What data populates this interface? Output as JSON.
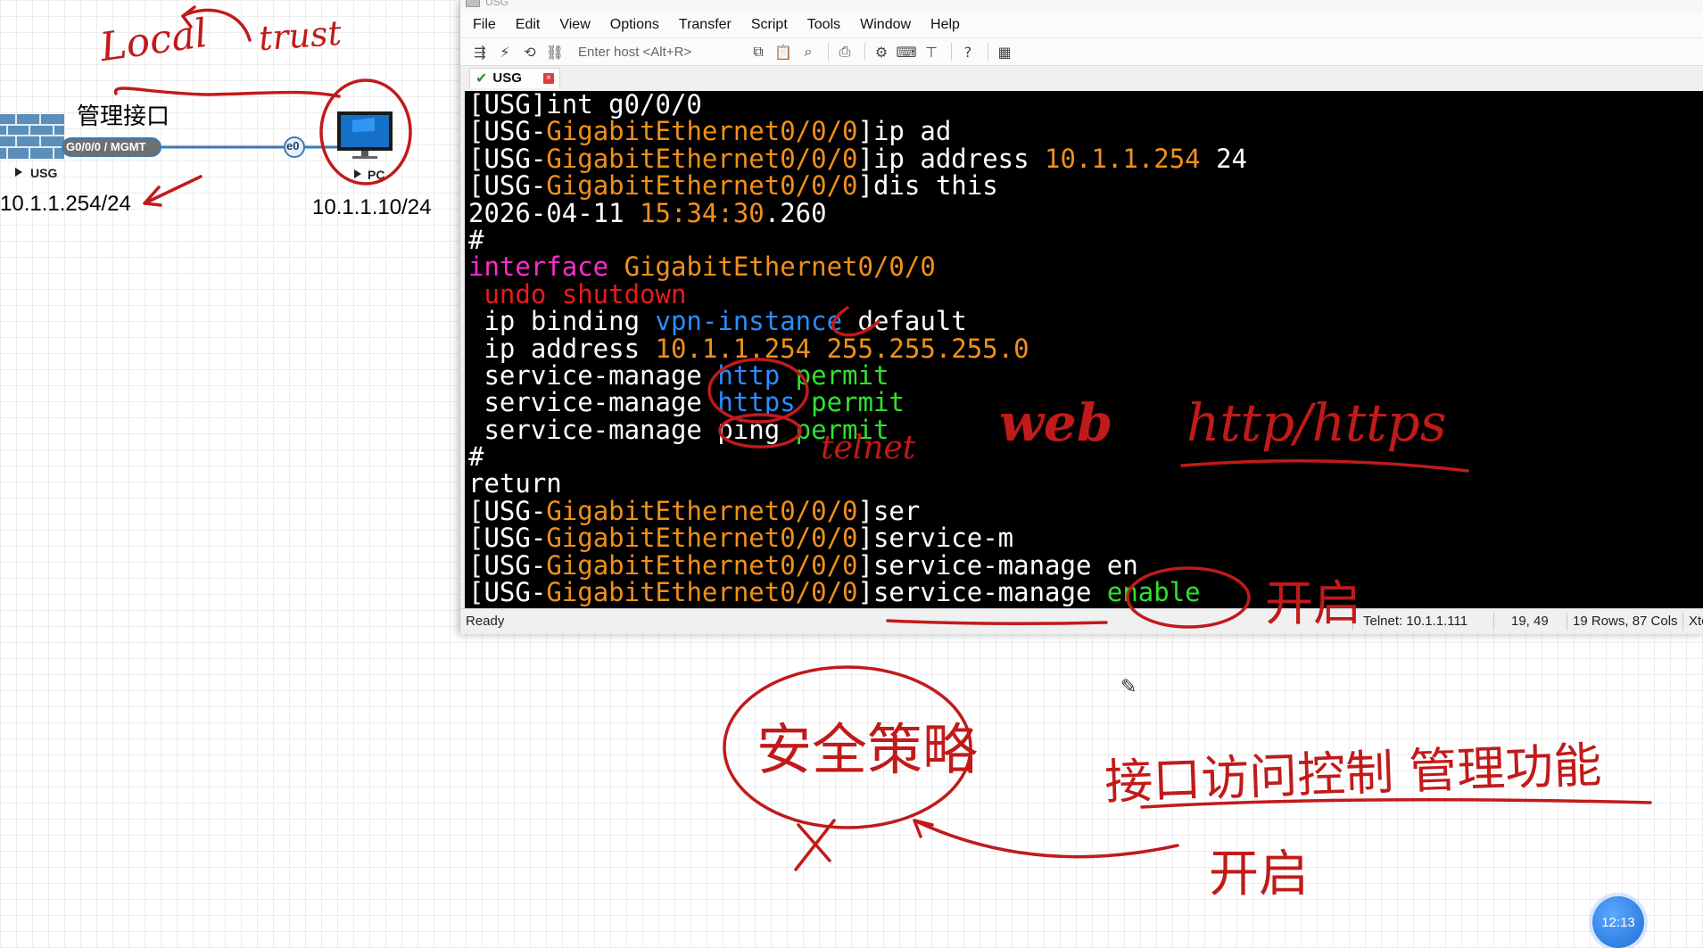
{
  "topology": {
    "nodes": [
      {
        "label": "USG",
        "icon": "firewall-icon"
      },
      {
        "label": "PC",
        "icon": "pc-icon"
      }
    ],
    "link": {
      "left_port": "G0/0/0 / MGMT",
      "right_port": "e0"
    },
    "usg_ip": "10.1.1.254/24",
    "pc_ip": "10.1.1.10/24",
    "mgmt_label": "管理接口"
  },
  "window": {
    "title": "USG",
    "menu": [
      "File",
      "Edit",
      "View",
      "Options",
      "Transfer",
      "Script",
      "Tools",
      "Window",
      "Help"
    ],
    "toolbar": {
      "host_placeholder": "Enter host <Alt+R>",
      "icons": [
        "connect-icon",
        "quick-connect-icon",
        "reconnect-icon",
        "disconnect-icon",
        "copy-icon",
        "paste-icon",
        "find-icon",
        "print-icon",
        "settings-icon",
        "keymap-icon",
        "sftp-icon",
        "help-icon",
        "map-icon"
      ]
    },
    "tab": {
      "label": "USG",
      "connected": true,
      "status_icon": "check-icon",
      "close_icon": "close-icon"
    },
    "terminal_lines": [
      [
        {
          "t": "[USG]int g0/0/0",
          "c": "w"
        }
      ],
      [
        {
          "t": "[USG-",
          "c": "w"
        },
        {
          "t": "GigabitEthernet0/0/0",
          "c": "o"
        },
        {
          "t": "]ip ad",
          "c": "w"
        }
      ],
      [
        {
          "t": "[USG-",
          "c": "w"
        },
        {
          "t": "GigabitEthernet0/0/0",
          "c": "o"
        },
        {
          "t": "]ip address ",
          "c": "w"
        },
        {
          "t": "10.1.1.254",
          "c": "o"
        },
        {
          "t": " 24",
          "c": "w"
        }
      ],
      [
        {
          "t": "[USG-",
          "c": "w"
        },
        {
          "t": "GigabitEthernet0/0/0",
          "c": "o"
        },
        {
          "t": "]dis this",
          "c": "w"
        }
      ],
      [
        {
          "t": "2026-04-11 ",
          "c": "w"
        },
        {
          "t": "15:34:30",
          "c": "o"
        },
        {
          "t": ".260",
          "c": "w"
        }
      ],
      [
        {
          "t": "#",
          "c": "w"
        }
      ],
      [
        {
          "t": "interface ",
          "c": "m"
        },
        {
          "t": "GigabitEthernet0/0/0",
          "c": "o"
        }
      ],
      [
        {
          "t": " undo shutdown",
          "c": "r"
        }
      ],
      [
        {
          "t": " ip binding ",
          "c": "w"
        },
        {
          "t": "vpn-instance",
          "c": "b"
        },
        {
          "t": " default",
          "c": "w"
        }
      ],
      [
        {
          "t": " ip address ",
          "c": "w"
        },
        {
          "t": "10.1.1.254 255.255.255.0",
          "c": "o"
        }
      ],
      [
        {
          "t": " service-manage ",
          "c": "w"
        },
        {
          "t": "http",
          "c": "b"
        },
        {
          "t": " permit",
          "c": "g"
        }
      ],
      [
        {
          "t": " service-manage ",
          "c": "w"
        },
        {
          "t": "https",
          "c": "b"
        },
        {
          "t": " permit",
          "c": "g"
        }
      ],
      [
        {
          "t": " service-manage ping ",
          "c": "w"
        },
        {
          "t": "permit",
          "c": "g"
        }
      ],
      [
        {
          "t": "#",
          "c": "w"
        }
      ],
      [
        {
          "t": "return",
          "c": "w"
        }
      ],
      [
        {
          "t": "[USG-",
          "c": "w"
        },
        {
          "t": "GigabitEthernet0/0/0",
          "c": "o"
        },
        {
          "t": "]ser",
          "c": "w"
        }
      ],
      [
        {
          "t": "[USG-",
          "c": "w"
        },
        {
          "t": "GigabitEthernet0/0/0",
          "c": "o"
        },
        {
          "t": "]service-m",
          "c": "w"
        }
      ],
      [
        {
          "t": "[USG-",
          "c": "w"
        },
        {
          "t": "GigabitEthernet0/0/0",
          "c": "o"
        },
        {
          "t": "]service-manage en",
          "c": "w"
        }
      ],
      [
        {
          "t": "[USG-",
          "c": "w"
        },
        {
          "t": "GigabitEthernet0/0/0",
          "c": "o"
        },
        {
          "t": "]service-manage ",
          "c": "w"
        },
        {
          "t": "enable",
          "c": "g"
        }
      ]
    ],
    "status": {
      "ready": "Ready",
      "session": "Telnet: 10.1.1.111",
      "cursor_pos": "19, 49",
      "size": "19 Rows, 87 Cols",
      "term": "Xte"
    }
  },
  "annotations": {
    "local": "Local",
    "trust": "trust",
    "telnet": "telnet",
    "web": "web",
    "http_https": "http/https",
    "open1": "开启",
    "security_policy": "安全策略",
    "interface_access_control": "接口访问控制 管理功能",
    "open2": "开启"
  },
  "colors": {
    "terminal_bg": "#000000",
    "orange": "#f0901a",
    "green": "#2fe22f",
    "blue": "#2a8dff",
    "magenta": "#ff2bd0",
    "red": "#e81b1b",
    "annotation_red": "#c11a1a"
  },
  "taskbar": {
    "clock": "12:13"
  }
}
